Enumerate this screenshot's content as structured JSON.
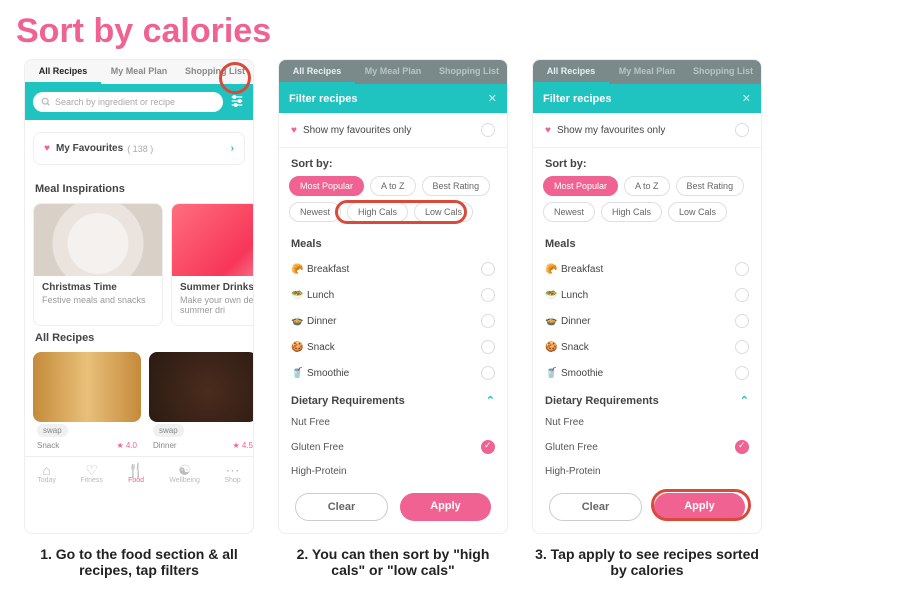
{
  "page_title": "Sort by calories",
  "tabs": {
    "all": "All Recipes",
    "plan": "My Meal Plan",
    "shop": "Shopping List"
  },
  "search": {
    "placeholder": "Search by ingredient or recipe"
  },
  "favourites": {
    "label": "My Favourites",
    "count": "( 138 )"
  },
  "inspirations": {
    "heading": "Meal Inspirations",
    "cards": [
      {
        "title": "Christmas Time",
        "sub": "Festive meals and snacks"
      },
      {
        "title": "Summer Drinks",
        "sub": "Make your own deli healthy summer dri"
      }
    ]
  },
  "all_recipes": {
    "heading": "All Recipes",
    "cards": [
      {
        "label": "Snack",
        "action": "swap",
        "rating": "★ 4.0"
      },
      {
        "label": "Dinner",
        "action": "swap",
        "rating": "★ 4.5"
      }
    ]
  },
  "bottom_nav": {
    "today": "Today",
    "fitness": "Fitness",
    "food": "Food",
    "wellbeing": "Wellbeing",
    "shop": "Shop"
  },
  "filter": {
    "title": "Filter recipes",
    "fav_only": "Show my favourites only",
    "sort_label": "Sort by:",
    "chips": {
      "popular": "Most Popular",
      "az": "A to Z",
      "rating": "Best Rating",
      "newest": "Newest",
      "high": "High Cals",
      "low": "Low Cals"
    },
    "meals_label": "Meals",
    "meals": {
      "breakfast": "Breakfast",
      "lunch": "Lunch",
      "dinner": "Dinner",
      "snack": "Snack",
      "smoothie": "Smoothie"
    },
    "dietary_label": "Dietary Requirements",
    "dietary": {
      "nut": "Nut Free",
      "gluten": "Gluten Free",
      "protein": "High-Protein"
    },
    "clear": "Clear",
    "apply": "Apply"
  },
  "captions": {
    "c1": "1. Go to the food section & all recipes, tap filters",
    "c2": "2.  You can then sort by \"high cals\" or \"low cals\"",
    "c3": "3.  Tap apply to see recipes sorted by calories"
  }
}
